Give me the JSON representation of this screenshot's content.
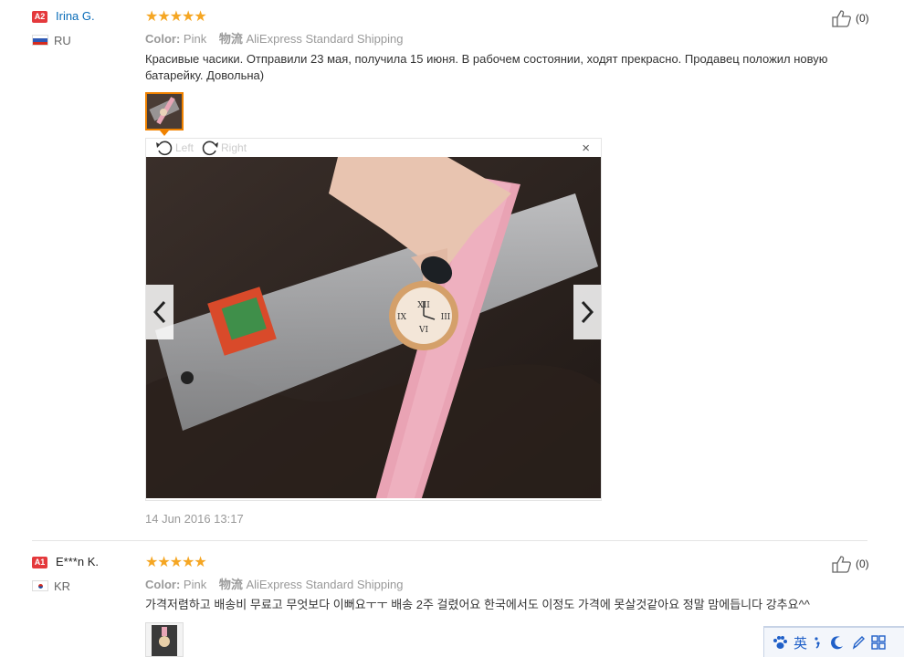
{
  "reviews": [
    {
      "badge": "A2",
      "name": "Irina G.",
      "country": "RU",
      "stars": "★★★★★",
      "color_label": "Color:",
      "color_value": "Pink",
      "ship_label": "物流",
      "ship_value": "AliExpress Standard Shipping",
      "text": "Красивые часики. Отправили 23 мая, получила 15 июня. В рабочем состоянии, ходят прекрасно. Продавец положил новую батарейку. Довольна)",
      "helpful": "(0)",
      "date": "14 Jun 2016 13:17"
    },
    {
      "badge": "A1",
      "name": "E***n K.",
      "country": "KR",
      "stars": "★★★★★",
      "color_label": "Color:",
      "color_value": "Pink",
      "ship_label": "物流",
      "ship_value": "AliExpress Standard Shipping",
      "text": "가격저렴하고 배송비 무료고 무엇보다 이뻐요ㅜㅜ 배송 2주 걸렸어요 한국에서도 이정도 가격에 못살것같아요 정말 맘에듭니다 강추요^^",
      "helpful": "(0)"
    }
  ],
  "viewer": {
    "rotate_left": "Left",
    "rotate_right": "Right",
    "close": "×"
  },
  "ime": {
    "lang": "英"
  }
}
